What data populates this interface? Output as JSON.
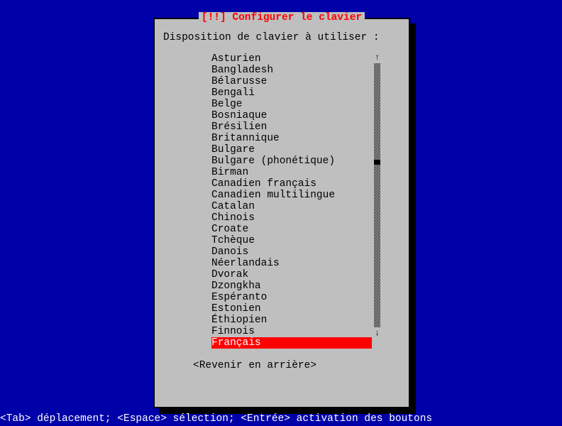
{
  "dialog": {
    "title": "[!!] Configurer le clavier",
    "prompt": "Disposition de clavier à utiliser :",
    "back_label": "<Revenir en arrière>",
    "scroll_up": "↑",
    "scroll_down": "↓",
    "items": [
      "Asturien",
      "Bangladesh",
      "Bélarusse",
      "Bengali",
      "Belge",
      "Bosniaque",
      "Brésilien",
      "Britannique",
      "Bulgare",
      "Bulgare (phonétique)",
      "Birman",
      "Canadien français",
      "Canadien multilingue",
      "Catalan",
      "Chinois",
      "Croate",
      "Tchèque",
      "Danois",
      "Néerlandais",
      "Dvorak",
      "Dzongkha",
      "Espéranto",
      "Estonien",
      "Éthiopien",
      "Finnois",
      "Français"
    ],
    "selected_index": 25
  },
  "footer": "<Tab> déplacement; <Espace> sélection; <Entrée> activation des boutons"
}
